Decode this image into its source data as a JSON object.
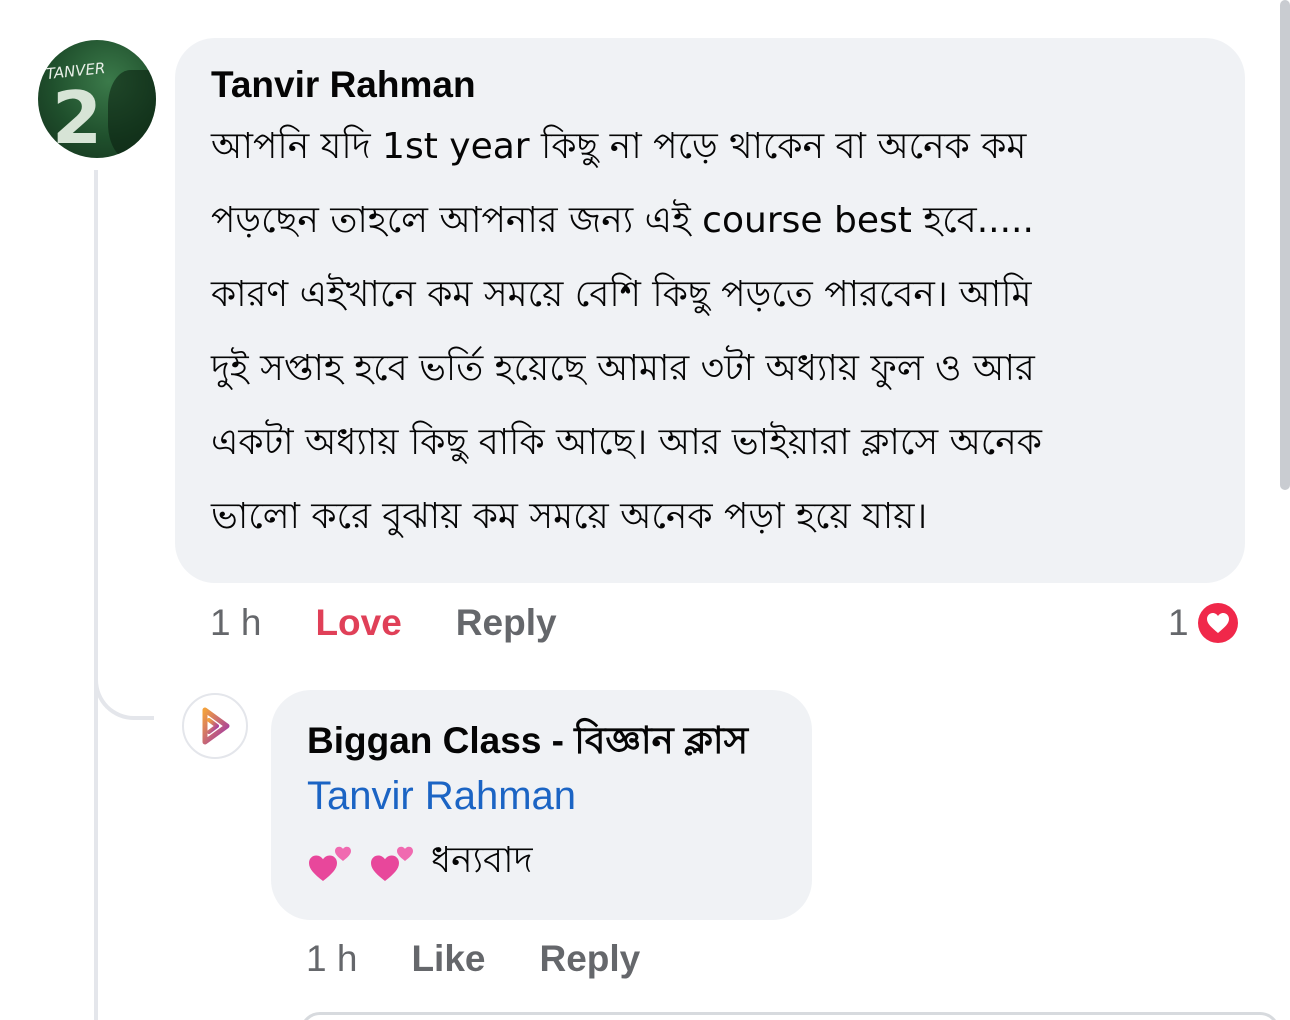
{
  "comment": {
    "author": "Tanvir Rahman",
    "avatar_jersey_name": "TANVER",
    "avatar_jersey_number": "2",
    "text_lines": [
      "আপনি যদি 1st year কিছু না পড়ে থাকেন বা অনেক কম",
      "পড়ছেন তাহলে আপনার জন্য এই course best হবে.....",
      "কারণ এইখানে কম সময়ে বেশি কিছু পড়তে পারবেন। আমি",
      "দুই সপ্তাহ হবে ভর্তি হয়েছে আমার ৩টা অধ্যায় ফুল ও আর",
      "একটা অধ্যায় কিছু বাকি আছে। আর ভাইয়ারা ক্লাসে অনেক",
      "ভালো করে বুঝায় কম সময়ে অনেক পড়া হয়ে যায়।"
    ],
    "time": "1 h",
    "love_label": "Love",
    "reply_label": "Reply",
    "reaction_count": "1",
    "reaction_icon": "love-reaction-icon",
    "reaction_color": "#f0284a"
  },
  "reply": {
    "author": "Biggan Class - বিজ্ঞান ক্লাস",
    "mention": "Tanvir Rahman",
    "emoji": [
      "two-hearts-emoji",
      "two-hearts-emoji"
    ],
    "text": "ধন্যবাদ",
    "time": "1 h",
    "like_label": "Like",
    "reply_label": "Reply",
    "page_logo_icon": "biggan-class-logo-icon"
  },
  "colors": {
    "bubble_bg": "#f0f2f5",
    "meta_text": "#65676b",
    "love_text": "#e04058",
    "mention_link": "#1b64c4",
    "logo_gradient_start": "#f2a03d",
    "logo_gradient_end": "#9b2fae"
  }
}
